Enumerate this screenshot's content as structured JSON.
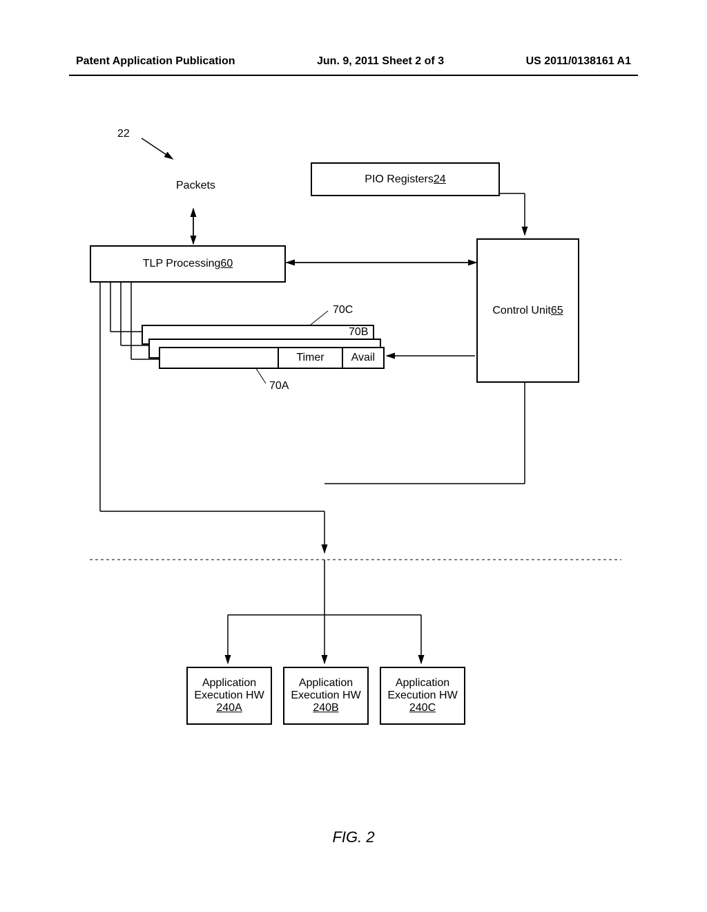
{
  "header": {
    "left": "Patent Application Publication",
    "center": "Jun. 9, 2011   Sheet 2 of 3",
    "right": "US 2011/0138161 A1"
  },
  "diagram": {
    "ref_22": "22",
    "packets_label": "Packets",
    "pio_registers": {
      "label": "PIO Registers ",
      "num": "24"
    },
    "tlp": {
      "label": "TLP Processing ",
      "num": "60"
    },
    "control_unit": {
      "label": "Control Unit ",
      "num": "65"
    },
    "timer_label": "Timer",
    "avail_label": "Avail",
    "ref_70A": "70A",
    "ref_70B": "70B",
    "ref_70C": "70C",
    "app_exec": {
      "label_line1": "Application",
      "label_line2": "Execution HW",
      "a": "240A",
      "b": "240B",
      "c": "240C"
    }
  },
  "figure_caption": "FIG. 2"
}
